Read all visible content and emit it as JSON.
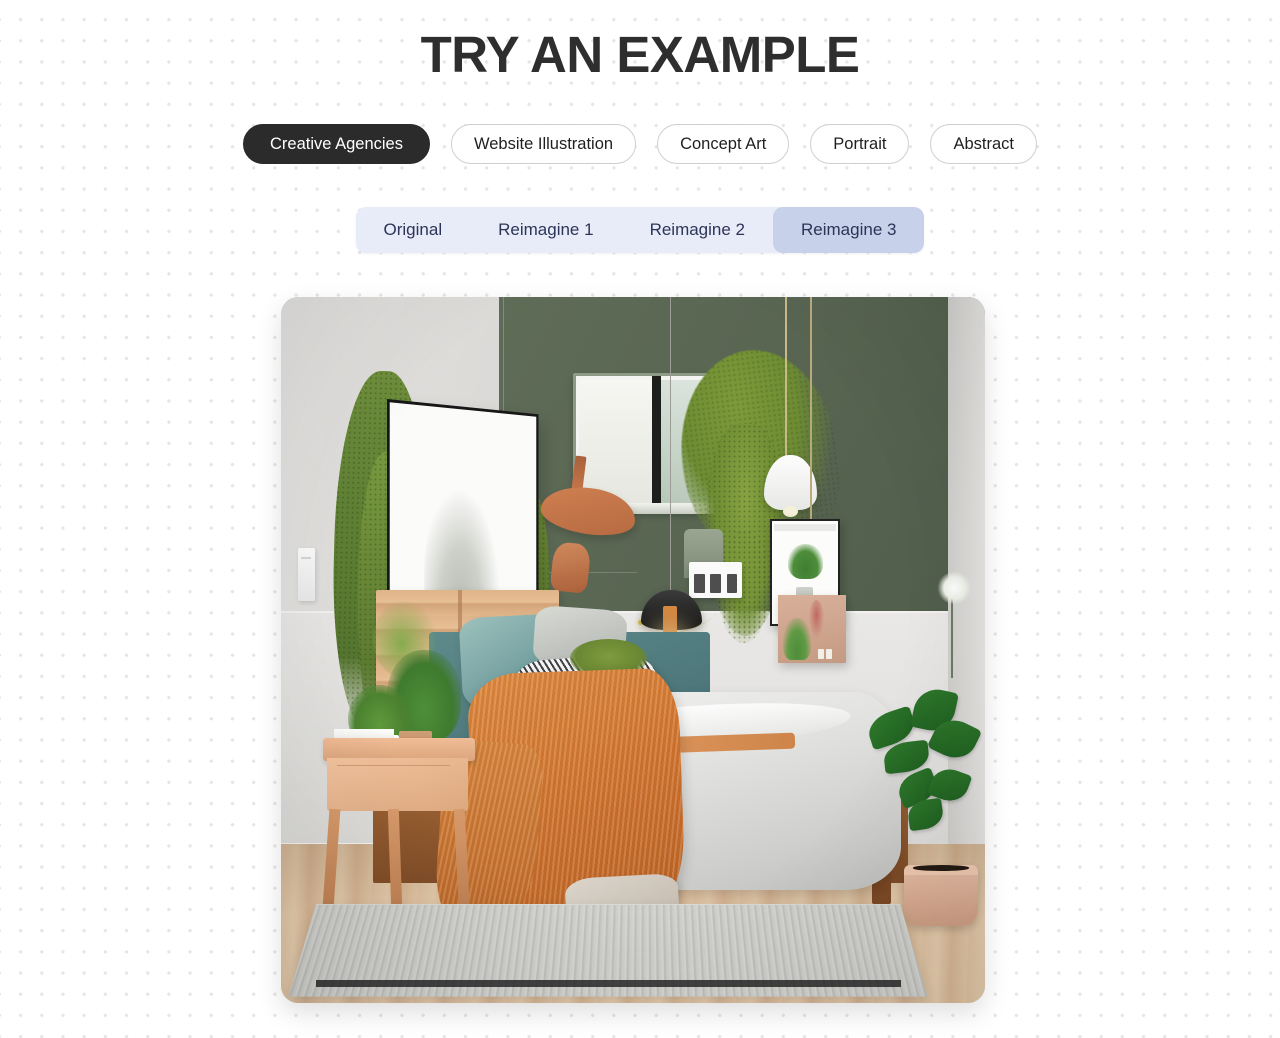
{
  "page": {
    "title": "TRY AN EXAMPLE"
  },
  "categories": {
    "items": [
      {
        "label": "Creative Agencies",
        "active": true
      },
      {
        "label": "Website Illustration",
        "active": false
      },
      {
        "label": "Concept Art",
        "active": false
      },
      {
        "label": "Portrait",
        "active": false
      },
      {
        "label": "Abstract",
        "active": false
      }
    ]
  },
  "variants": {
    "items": [
      {
        "label": "Original",
        "active": false
      },
      {
        "label": "Reimagine 1",
        "active": false
      },
      {
        "label": "Reimagine 2",
        "active": false
      },
      {
        "label": "Reimagine 3",
        "active": true
      }
    ],
    "selected": "Reimagine 3"
  },
  "preview": {
    "name": "bedroom-interior-preview",
    "description": "Modern bedroom interior with olive green accent wall, hanging plants, wooden bed with white duvet and orange throw blanket, teal pillows, nightstand with potted plants, pendant lamps and a light wood floor with a grey rug."
  },
  "colors": {
    "title": "#2e2e2e",
    "pill_active_bg": "#2b2b2b",
    "pill_active_text": "#ffffff",
    "pill_bg": "#ffffff",
    "pill_border": "#cfcfcf",
    "segment_bg": "#e8ecf9",
    "segment_active_bg": "#c7d1e9",
    "segment_text": "#2c3557",
    "page_bg": "#ffffff",
    "dot_grid": "#e6e6e6",
    "accent_green_wall": "#5d6b55",
    "accent_orange_throw": "#d4762f",
    "accent_teal_pillow": "#6f9b9c"
  }
}
